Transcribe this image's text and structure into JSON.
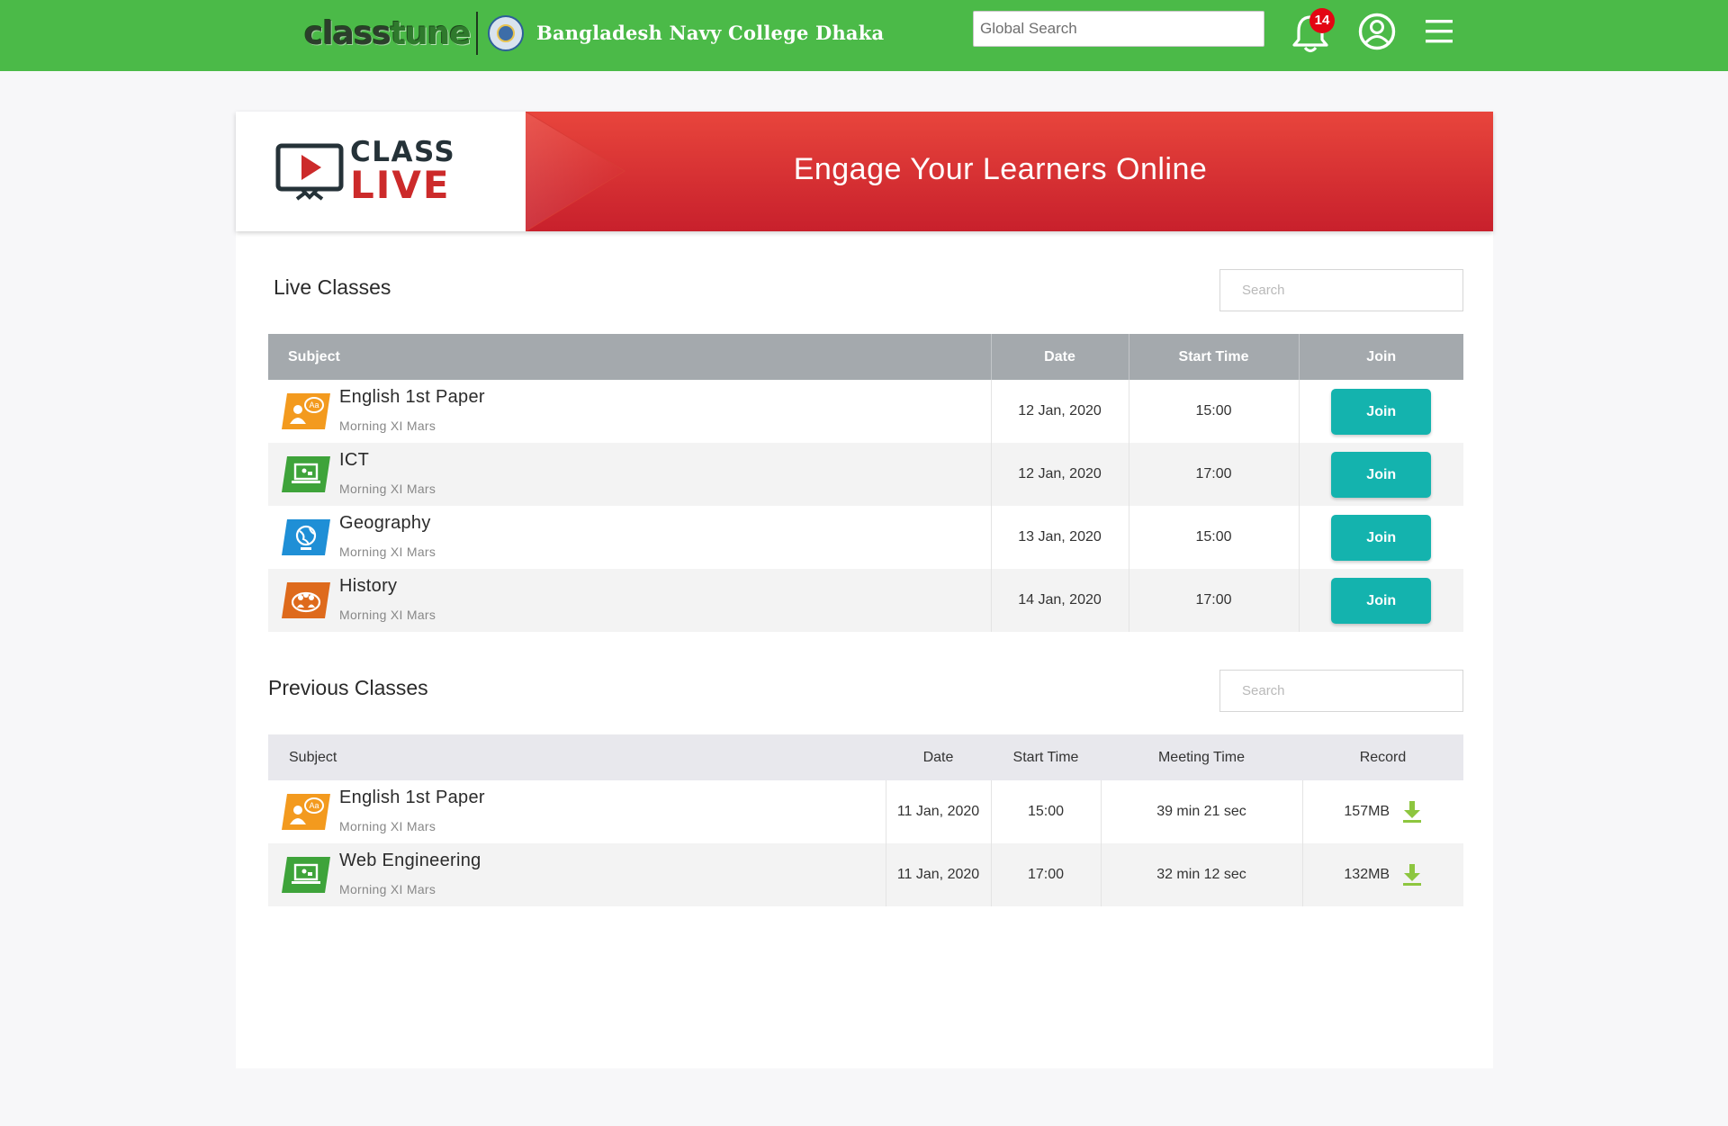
{
  "header": {
    "logo_part1": "class",
    "logo_part2": "tune",
    "college_name": "Bangladesh Navy College Dhaka",
    "search_placeholder": "Global Search",
    "notification_count": "14",
    "brand_color": "#4bba48"
  },
  "banner": {
    "logo_line1": "CLASS",
    "logo_line2": "LIVE",
    "tagline": "Engage Your Learners Online",
    "accent_color": "#cc2a2a"
  },
  "live_classes": {
    "title": "Live Classes",
    "search_placeholder": "Search",
    "columns": [
      "Subject",
      "Date",
      "Start Time",
      "Join"
    ],
    "rows": [
      {
        "subject": "English 1st Paper",
        "section": "Morning XI Mars",
        "date": "12 Jan, 2020",
        "start_time": "15:00",
        "action": "Join",
        "icon": "english-icon"
      },
      {
        "subject": "ICT",
        "section": "Morning XI Mars",
        "date": "12 Jan, 2020",
        "start_time": "17:00",
        "action": "Join",
        "icon": "ict-icon"
      },
      {
        "subject": "Geography",
        "section": "Morning XI Mars",
        "date": "13 Jan, 2020",
        "start_time": "15:00",
        "action": "Join",
        "icon": "geography-icon"
      },
      {
        "subject": "History",
        "section": "Morning XI Mars",
        "date": "14 Jan, 2020",
        "start_time": "17:00",
        "action": "Join",
        "icon": "history-icon"
      }
    ]
  },
  "previous_classes": {
    "title": "Previous Classes",
    "search_placeholder": "Search",
    "columns": [
      "Subject",
      "Date",
      "Start Time",
      "Meeting Time",
      "Record"
    ],
    "rows": [
      {
        "subject": "English 1st Paper",
        "section": "Morning XI Mars",
        "date": "11 Jan, 2020",
        "start_time": "15:00",
        "meeting_time": "39 min 21 sec",
        "record_size": "157MB",
        "icon": "english-icon"
      },
      {
        "subject": "Web Engineering",
        "section": "Morning XI Mars",
        "date": "11 Jan, 2020",
        "start_time": "17:00",
        "meeting_time": "32 min 12 sec",
        "record_size": "132MB",
        "icon": "ict-icon"
      }
    ]
  },
  "colors": {
    "join_button": "#14b3ae",
    "download_icon": "#8dc63f"
  }
}
